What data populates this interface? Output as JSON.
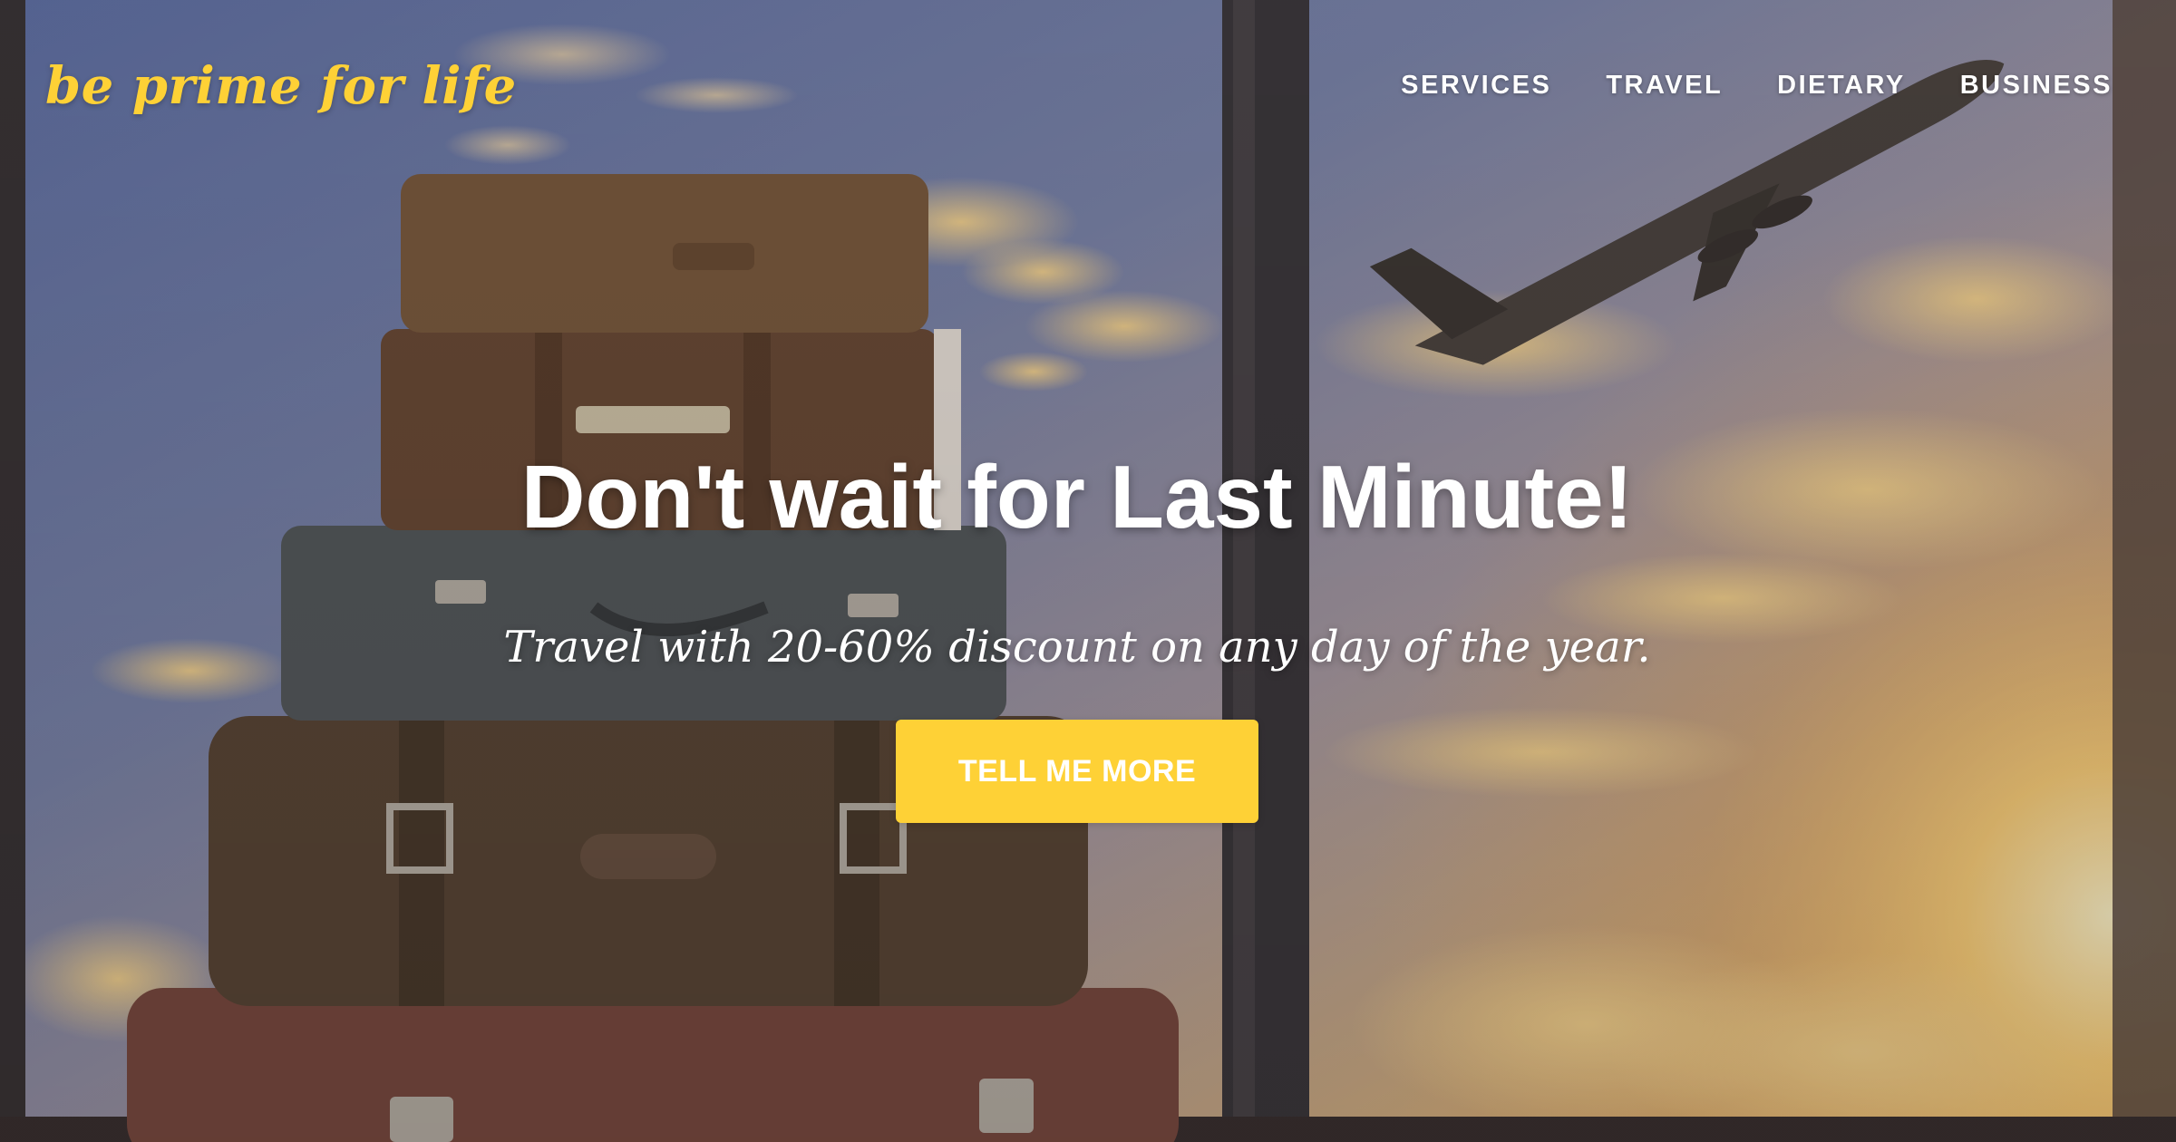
{
  "brand": {
    "name": "be prime for life"
  },
  "nav": {
    "items": [
      {
        "label": "SERVICES"
      },
      {
        "label": "TRAVEL"
      },
      {
        "label": "DIETARY"
      },
      {
        "label": "BUSINESS"
      }
    ]
  },
  "hero": {
    "title": "Don't wait for Last Minute!",
    "subtitle": "Travel with 20-60% discount on any day of the year.",
    "cta_label": "TELL ME MORE"
  },
  "colors": {
    "accent": "#fed136",
    "text": "#ffffff"
  }
}
